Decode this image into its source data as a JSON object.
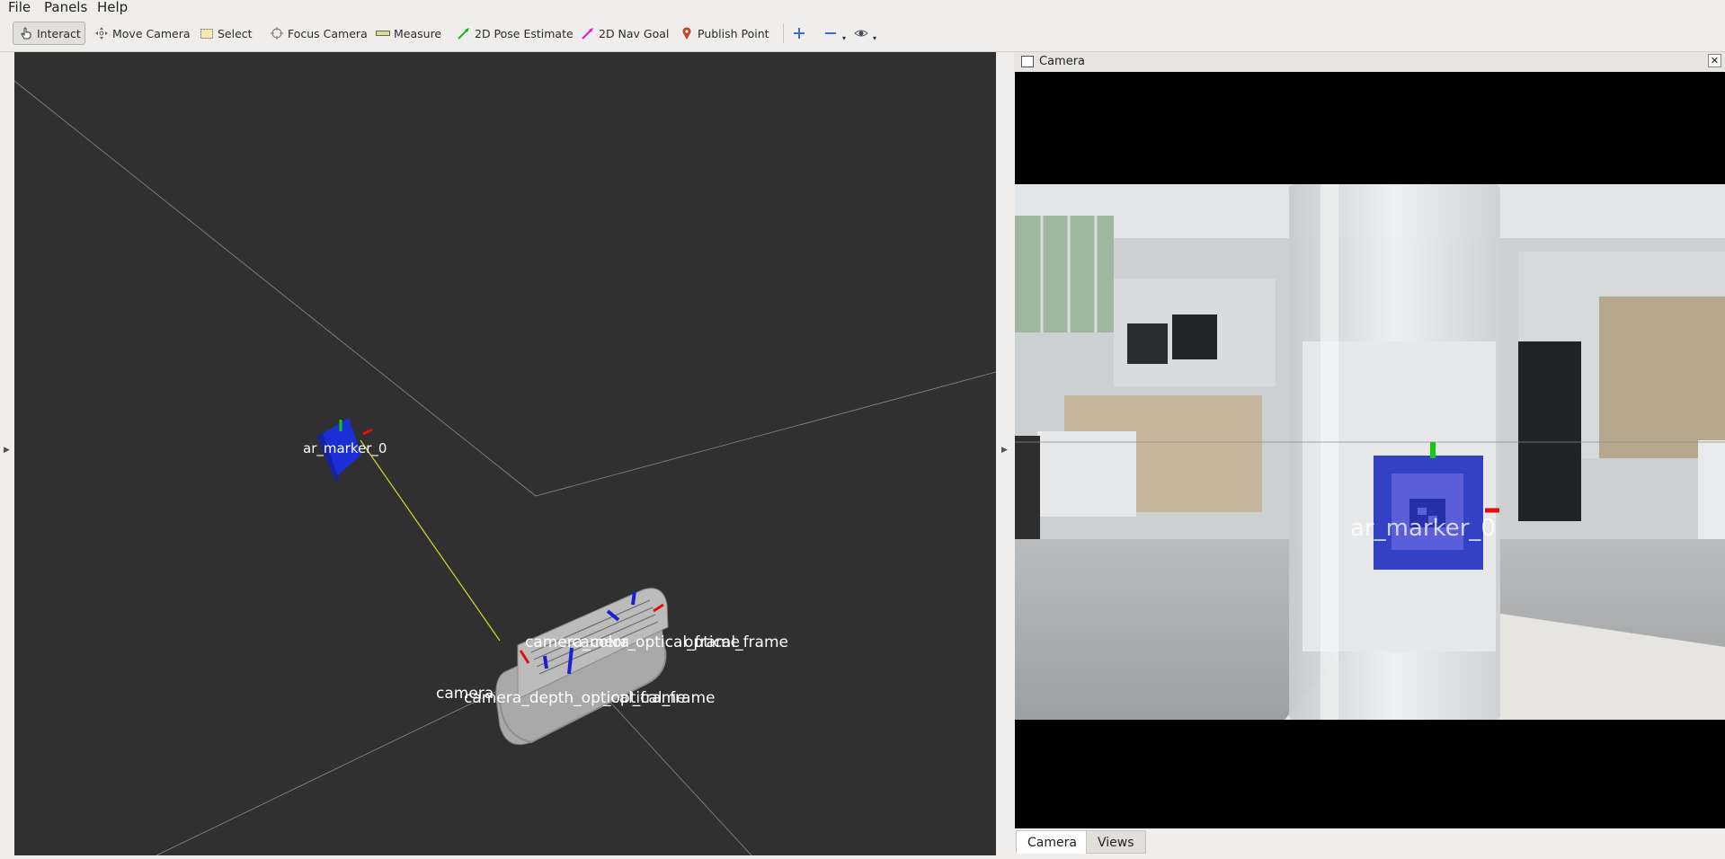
{
  "menu": {
    "file": "File",
    "panels": "Panels",
    "help": "Help"
  },
  "toolbar": {
    "interact": "Interact",
    "move_camera": "Move Camera",
    "select": "Select",
    "focus_camera": "Focus Camera",
    "measure": "Measure",
    "pose_estimate": "2D Pose Estimate",
    "nav_goal": "2D Nav Goal",
    "publish_point": "Publish Point"
  },
  "viewport": {
    "marker_label": "ar_marker_0",
    "frame_labels": {
      "top": "camera_color_optical_frame",
      "top_left_fragment": "camera",
      "top_right_fragment": "optical_frame",
      "bottom": "camera_depth_optical_frame",
      "bottom_left_fragment": "camera",
      "bottom_right_fragment": "_optical_frame"
    }
  },
  "camera_panel": {
    "title": "Camera",
    "overlay_label": "ar_marker_0",
    "tabs": [
      "Camera",
      "Views"
    ]
  },
  "colors": {
    "background": "#303030",
    "marker_blue": "#1a2fd6",
    "axis_red": "#e01010",
    "axis_green": "#14c814",
    "axis_blue": "#1a22d0",
    "link_yellow": "#d8d830"
  }
}
